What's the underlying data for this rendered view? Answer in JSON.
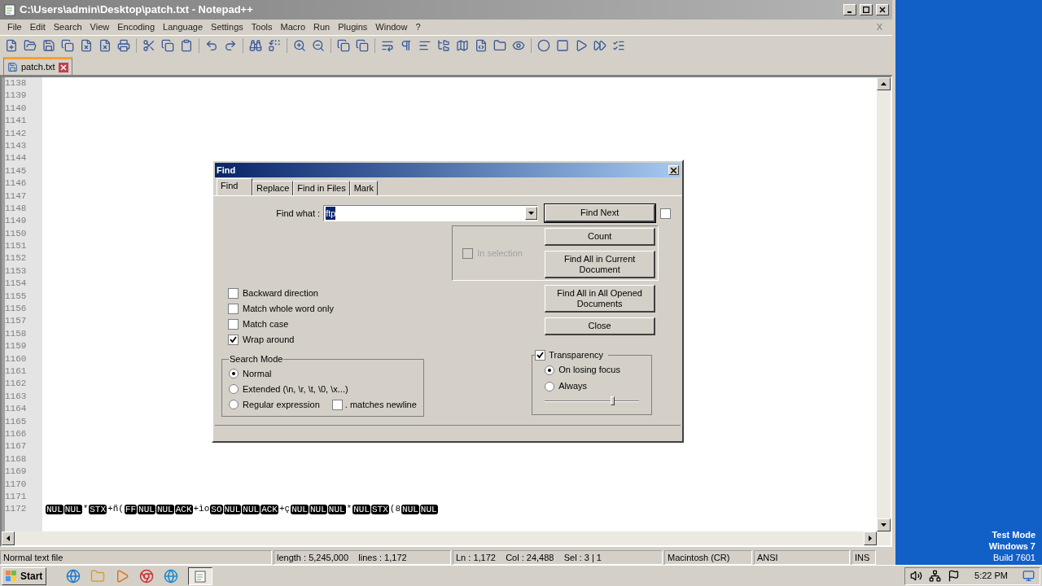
{
  "window": {
    "title": "C:\\Users\\admin\\Desktop\\patch.txt - Notepad++",
    "close_doc": "X"
  },
  "menu": [
    "File",
    "Edit",
    "Search",
    "View",
    "Encoding",
    "Language",
    "Settings",
    "Tools",
    "Macro",
    "Run",
    "Plugins",
    "Window",
    "?"
  ],
  "tabs": [
    {
      "label": "patch.txt",
      "selected": true
    }
  ],
  "editor": {
    "line_numbers": [
      "1138",
      "1139",
      "1140",
      "1141",
      "1142",
      "1143",
      "1144",
      "1145",
      "1146",
      "1147",
      "1148",
      "1149",
      "1150",
      "1151",
      "1152",
      "1153",
      "1154",
      "1155",
      "1156",
      "1157",
      "1158",
      "1159",
      "1160",
      "1161",
      "1162",
      "1163",
      "1164",
      "1165",
      "1166",
      "1167",
      "1168",
      "1169",
      "1170",
      "1171",
      "1172"
    ],
    "last_line": [
      {
        "kind": "ctrl",
        "text": "NUL"
      },
      {
        "kind": "ctrl",
        "text": "NUL"
      },
      {
        "kind": "plain",
        "text": "*"
      },
      {
        "kind": "ctrl",
        "text": "STX"
      },
      {
        "kind": "plain",
        "text": "+ñ("
      },
      {
        "kind": "ctrl",
        "text": "FF"
      },
      {
        "kind": "ctrl",
        "text": "NUL"
      },
      {
        "kind": "ctrl",
        "text": "NUL"
      },
      {
        "kind": "ctrl",
        "text": "ACK"
      },
      {
        "kind": "plain",
        "text": "+ìo"
      },
      {
        "kind": "ctrl",
        "text": "SO"
      },
      {
        "kind": "ctrl",
        "text": "NUL"
      },
      {
        "kind": "ctrl",
        "text": "NUL"
      },
      {
        "kind": "ctrl",
        "text": "ACK"
      },
      {
        "kind": "plain",
        "text": "+ç"
      },
      {
        "kind": "ctrl",
        "text": "NUL"
      },
      {
        "kind": "ctrl",
        "text": "NUL"
      },
      {
        "kind": "ctrl",
        "text": "NUL"
      },
      {
        "kind": "plain",
        "text": "*"
      },
      {
        "kind": "ctrl",
        "text": "NUL"
      },
      {
        "kind": "ctrl",
        "text": "STX"
      },
      {
        "kind": "plain",
        "text": "(8"
      },
      {
        "kind": "ctrl",
        "text": "NUL"
      },
      {
        "kind": "ctrl",
        "text": "NUL"
      }
    ]
  },
  "find_dialog": {
    "title": "Find",
    "tabs": [
      {
        "label": "Find",
        "selected": true
      },
      {
        "label": "Replace",
        "selected": false
      },
      {
        "label": "Find in Files",
        "selected": false
      },
      {
        "label": "Mark",
        "selected": false
      }
    ],
    "find_what": {
      "label": "Find what :",
      "value": "ftp",
      "selected": true
    },
    "side_checkbox": {
      "checked": false
    },
    "in_selection": {
      "label": "In selection",
      "checked": false,
      "disabled": true
    },
    "buttons": [
      {
        "label": "Find Next",
        "default": true
      },
      {
        "label": "Count",
        "default": false
      },
      {
        "label": "Find All in Current Document",
        "default": false
      },
      {
        "label": "Find All in All Opened Documents",
        "default": false
      },
      {
        "label": "Close",
        "default": false
      }
    ],
    "options": [
      {
        "label": "Backward direction",
        "checked": false
      },
      {
        "label": "Match whole word only",
        "checked": false
      },
      {
        "label": "Match case",
        "checked": false
      },
      {
        "label": "Wrap around",
        "checked": true
      }
    ],
    "search_mode": {
      "label": "Search Mode",
      "modes": [
        {
          "label": "Normal",
          "selected": true
        },
        {
          "label": "Extended (\\n, \\r, \\t, \\0, \\x...)",
          "selected": false
        },
        {
          "label": "Regular expression",
          "selected": false
        }
      ],
      "matches_newline": {
        "label": ". matches newline",
        "checked": false
      }
    },
    "transparency": {
      "label": "Transparency",
      "checked": true,
      "modes": [
        {
          "label": "On losing focus",
          "selected": true
        },
        {
          "label": "Always",
          "selected": false
        }
      ],
      "level": 0.72
    }
  },
  "status_bar": [
    "Normal text file",
    "length : 5,245,000    lines : 1,172",
    "Ln : 1,172    Col : 24,488    Sel : 3 | 1",
    "Macintosh (CR)",
    "ANSI",
    "INS"
  ],
  "desktop": {
    "lines": [
      "Test Mode",
      "Windows 7",
      "Build 7601"
    ]
  },
  "taskbar": {
    "start": "Start",
    "clock": "5:22 PM"
  }
}
